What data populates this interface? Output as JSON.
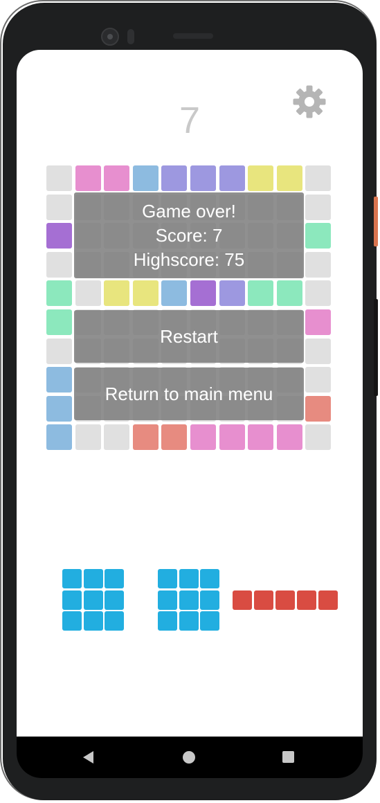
{
  "score": "7",
  "settings_icon": "gear-icon",
  "board": {
    "size": 10,
    "empty_color": "#e0e0e0",
    "rows": [
      [
        "#e0e0e0",
        "#e78fcf",
        "#e78fcf",
        "#8dbbe0",
        "#9d98e0",
        "#9d98e0",
        "#9d98e0",
        "#e8e57e",
        "#e8e57e",
        "#e0e0e0"
      ],
      [
        "#e0e0e0",
        "#e0e0e0",
        "#e0e0e0",
        "#e0e0e0",
        "#e0e0e0",
        "#e0e0e0",
        "#e0e0e0",
        "#e0e0e0",
        "#e0e0e0",
        "#e0e0e0"
      ],
      [
        "#a56fd3",
        "#e0e0e0",
        "#e0e0e0",
        "#e0e0e0",
        "#e0e0e0",
        "#e0e0e0",
        "#e0e0e0",
        "#e0e0e0",
        "#e0e0e0",
        "#8ce8bd"
      ],
      [
        "#e0e0e0",
        "#e0e0e0",
        "#e0e0e0",
        "#e0e0e0",
        "#e0e0e0",
        "#e0e0e0",
        "#e0e0e0",
        "#e0e0e0",
        "#e0e0e0",
        "#e0e0e0"
      ],
      [
        "#8ce8bd",
        "#e0e0e0",
        "#e8e57e",
        "#e8e57e",
        "#8dbbe0",
        "#a56fd3",
        "#9d98e0",
        "#8ce8bd",
        "#8ce8bd",
        "#e0e0e0"
      ],
      [
        "#8ce8bd",
        "#e0e0e0",
        "#e0e0e0",
        "#e0e0e0",
        "#e0e0e0",
        "#e0e0e0",
        "#e0e0e0",
        "#e0e0e0",
        "#e0e0e0",
        "#e78fcf"
      ],
      [
        "#e0e0e0",
        "#e0e0e0",
        "#e0e0e0",
        "#e0e0e0",
        "#e0e0e0",
        "#e0e0e0",
        "#e0e0e0",
        "#e0e0e0",
        "#e0e0e0",
        "#e0e0e0"
      ],
      [
        "#8dbbe0",
        "#e0e0e0",
        "#e0e0e0",
        "#e0e0e0",
        "#e0e0e0",
        "#e0e0e0",
        "#e0e0e0",
        "#e0e0e0",
        "#e0e0e0",
        "#e0e0e0"
      ],
      [
        "#8dbbe0",
        "#e0e0e0",
        "#e0e0e0",
        "#e0e0e0",
        "#e0e0e0",
        "#e0e0e0",
        "#e0e0e0",
        "#e0e0e0",
        "#e0e0e0",
        "#e78b80"
      ],
      [
        "#8dbbe0",
        "#e0e0e0",
        "#e0e0e0",
        "#e78b80",
        "#e78b80",
        "#e78fcf",
        "#e78fcf",
        "#e78fcf",
        "#e78fcf",
        "#e0e0e0"
      ]
    ]
  },
  "game_over": {
    "title": "Game over!",
    "score_line": "Score: 7",
    "highscore_line": "Highscore: 75"
  },
  "buttons": {
    "restart": "Restart",
    "return_menu": "Return to main menu"
  },
  "pieces": [
    {
      "name": "square-3x3",
      "color": "#22aee0",
      "rows": 3,
      "cols": 3
    },
    {
      "name": "square-3x3",
      "color": "#22aee0",
      "rows": 3,
      "cols": 3
    },
    {
      "name": "line-1x5",
      "color": "#d94c42",
      "rows": 1,
      "cols": 5
    }
  ],
  "colors": {
    "overlay": "#7a7a7a",
    "score_text": "#c9c9c9",
    "gear": "#b5b5b5"
  }
}
